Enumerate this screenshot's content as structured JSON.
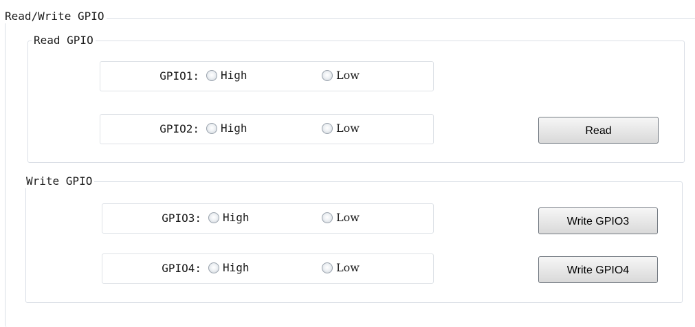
{
  "panel": {
    "title": "Read/Write GPIO"
  },
  "read_group": {
    "title": "Read GPIO",
    "rows": [
      {
        "label": "GPIO1:",
        "high_label": "High",
        "low_label": "Low"
      },
      {
        "label": "GPIO2:",
        "high_label": "High",
        "low_label": "Low"
      }
    ],
    "read_button": "Read"
  },
  "write_group": {
    "title": "Write GPIO",
    "rows": [
      {
        "label": "GPIO3:",
        "high_label": "High",
        "low_label": "Low",
        "button": "Write GPIO3"
      },
      {
        "label": "GPIO4:",
        "high_label": "High",
        "low_label": "Low",
        "button": "Write GPIO4"
      }
    ]
  }
}
